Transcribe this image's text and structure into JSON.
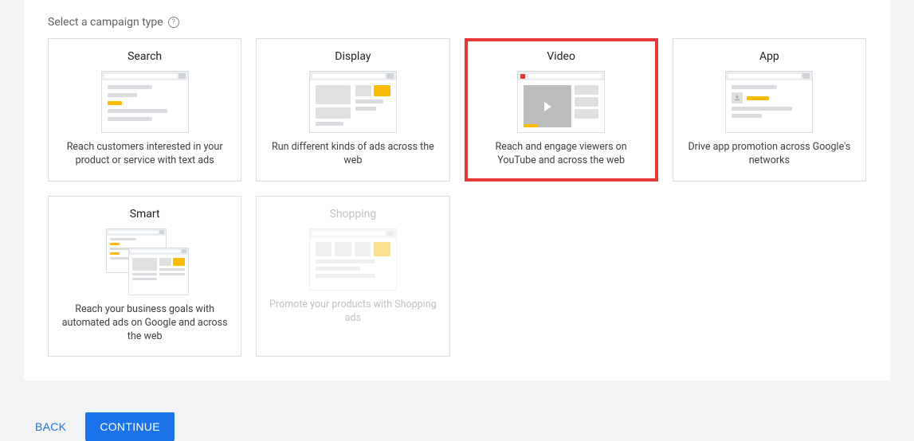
{
  "section": {
    "title": "Select a campaign type"
  },
  "cards": {
    "search": {
      "title": "Search",
      "desc": "Reach customers interested in your product or service with text ads"
    },
    "display": {
      "title": "Display",
      "desc": "Run different kinds of ads across the web"
    },
    "video": {
      "title": "Video",
      "desc": "Reach and engage viewers on YouTube and across the web"
    },
    "app": {
      "title": "App",
      "desc": "Drive app promotion across Google's networks"
    },
    "smart": {
      "title": "Smart",
      "desc": "Reach your business goals with automated ads on Google and across the web"
    },
    "shopping": {
      "title": "Shopping",
      "desc": "Promote your products with Shopping ads"
    }
  },
  "footer": {
    "back": "BACK",
    "continue": "CONTINUE"
  }
}
